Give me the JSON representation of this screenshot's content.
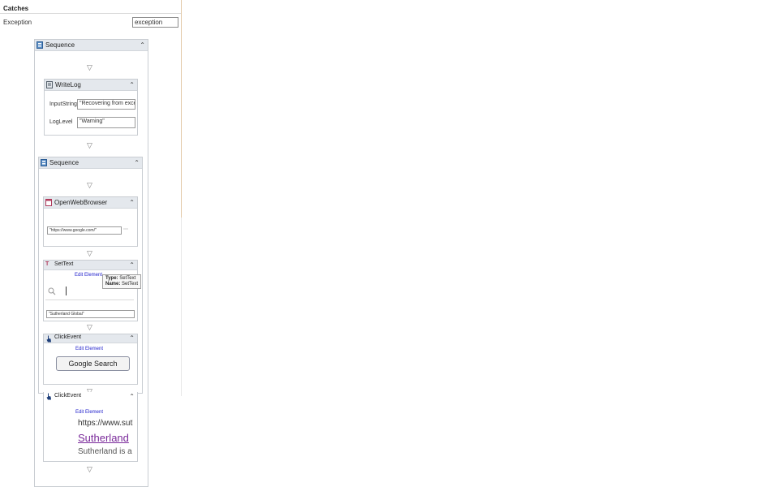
{
  "catches": {
    "header": "Catches",
    "exception_label": "Exception",
    "exception_value": "exception"
  },
  "sequence_outer": {
    "title": "Sequence"
  },
  "writelog": {
    "title": "WriteLog",
    "input_label": "InputString",
    "input_value": "\"Recovering from exce",
    "level_label": "LogLevel",
    "level_value": "\"Warning\""
  },
  "sequence_inner": {
    "title": "Sequence"
  },
  "openbrowser": {
    "title": "OpenWebBrowser",
    "url_value": "\"https://www.google.com/\""
  },
  "settext": {
    "title": "SetText",
    "edit_element": "Edit Element",
    "tooltip": {
      "type_label": "Type:",
      "type_value": "SetText",
      "name_label": "Name:",
      "name_value": "SetText"
    },
    "text_value": "\"Sutherland Global\""
  },
  "clickevent1": {
    "title": "ClickEvent",
    "edit_element": "Edit Element",
    "button_label": "Google Search"
  },
  "clickevent2": {
    "title": "ClickEvent",
    "edit_element": "Edit Element",
    "preview_url": "https://www.sutl",
    "preview_link": "Sutherland",
    "preview_text": "Sutherland is a"
  },
  "icons": {
    "sequence": "sequence-icon",
    "writelog": "writelog-icon",
    "browser": "browser-icon",
    "settext": "settext-icon",
    "click": "hand-pointer-icon",
    "collapse": "double-chevron-up-icon",
    "arrow": "down-triangle-icon",
    "search": "magnifier-icon"
  },
  "colors": {
    "header_bar": "#e4e8ed",
    "link": "#2222cc",
    "preview_link": "#7a2a9a"
  }
}
